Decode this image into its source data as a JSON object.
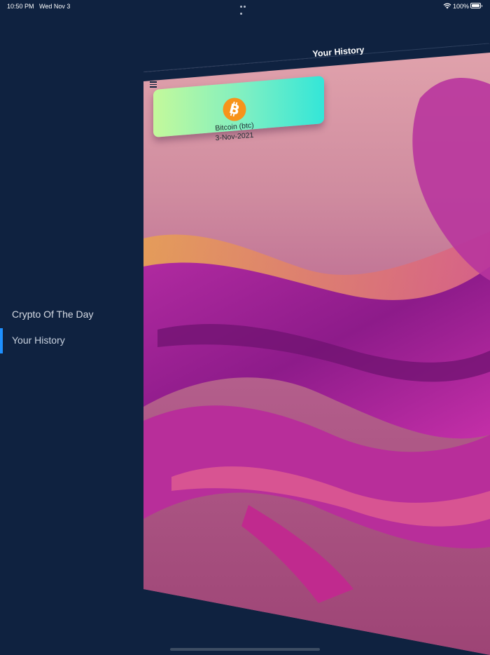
{
  "status_bar": {
    "time": "10:50 PM",
    "date": "Wed Nov 3",
    "battery": "100%",
    "icons": [
      "wifi-icon",
      "battery-icon",
      "more-dots-icon"
    ]
  },
  "header": {
    "title": "Your History",
    "menu_icon": "hamburger-icon"
  },
  "side_menu": {
    "items": [
      {
        "label": "Crypto Of The Day",
        "active": false
      },
      {
        "label": "Your History",
        "active": true
      }
    ]
  },
  "history": {
    "items": [
      {
        "name": "Bitcoin (btc)",
        "date": "3-Nov-2021",
        "icon": "bitcoin-icon"
      }
    ]
  },
  "colors": {
    "sidebar_bg": "#0f2240",
    "active_indicator": "#1e90ff",
    "card_gradient_start": "#c4f99b",
    "card_gradient_end": "#33e6d8",
    "bitcoin_orange": "#f7931a"
  }
}
